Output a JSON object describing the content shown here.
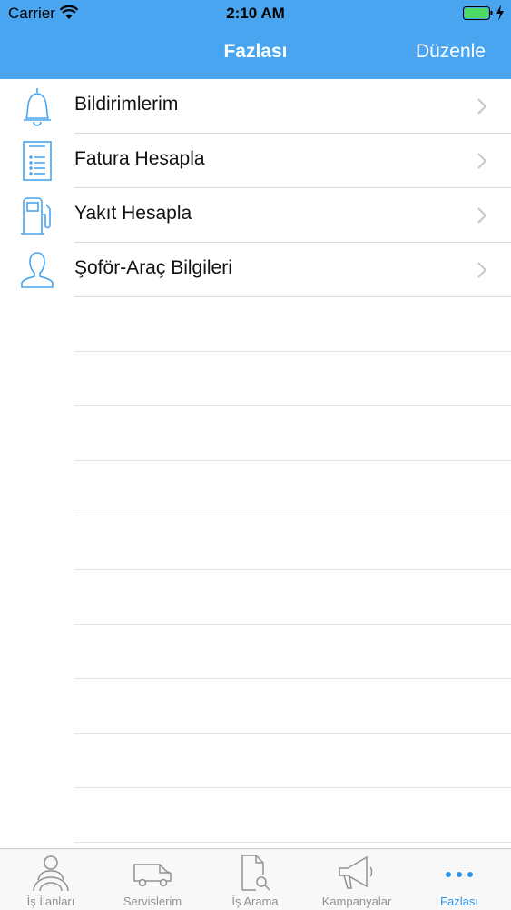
{
  "status_bar": {
    "carrier": "Carrier",
    "time": "2:10 AM"
  },
  "nav": {
    "title": "Fazlası",
    "edit_label": "Düzenle"
  },
  "menu": [
    {
      "label": "Bildirimlerim",
      "icon": "bell-icon"
    },
    {
      "label": "Fatura Hesapla",
      "icon": "invoice-icon"
    },
    {
      "label": "Yakıt Hesapla",
      "icon": "fuel-pump-icon"
    },
    {
      "label": "Şoför-Araç Bilgileri",
      "icon": "person-icon"
    }
  ],
  "tabs": [
    {
      "label": "İş İlanları",
      "icon": "driver-steering-icon",
      "active": false
    },
    {
      "label": "Servislerim",
      "icon": "van-icon",
      "active": false
    },
    {
      "label": "İş Arama",
      "icon": "document-search-icon",
      "active": false
    },
    {
      "label": "Kampanyalar",
      "icon": "megaphone-icon",
      "active": false
    },
    {
      "label": "Fazlası",
      "icon": "more-dots-icon",
      "active": true
    }
  ],
  "colors": {
    "accent": "#49a5f0",
    "tab_active": "#3197e8",
    "tab_inactive": "#929292",
    "battery": "#4cd964"
  }
}
